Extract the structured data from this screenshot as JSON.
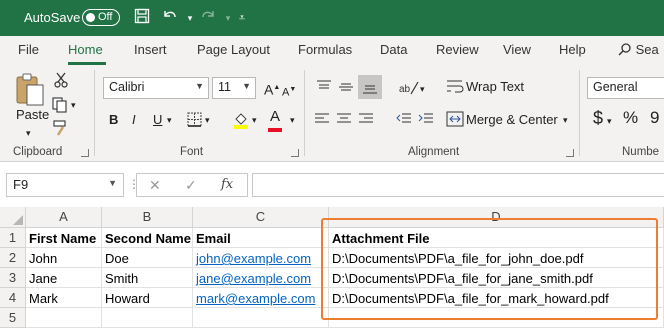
{
  "titlebar": {
    "autosave_label": "AutoSave",
    "autosave_state": "Off",
    "accent": "#217346"
  },
  "tabs": [
    "File",
    "Home",
    "Insert",
    "Page Layout",
    "Formulas",
    "Data",
    "Review",
    "View",
    "Help",
    "Sea"
  ],
  "active_tab": "Home",
  "ribbon": {
    "clipboard": {
      "paste_label": "Paste",
      "group_label": "Clipboard"
    },
    "font": {
      "font_name": "Calibri",
      "font_size": "11",
      "bold": "B",
      "italic": "I",
      "underline": "U",
      "font_color_letter": "A",
      "group_label": "Font"
    },
    "alignment": {
      "wrap_text": "Wrap Text",
      "merge_center": "Merge & Center",
      "group_label": "Alignment"
    },
    "number": {
      "format": "General",
      "currency": "$",
      "percent": "%",
      "group_label": "Numbe"
    }
  },
  "formula_bar": {
    "name_box": "F9",
    "cancel_glyph": "✕",
    "enter_glyph": "✓",
    "fx_label": "fx",
    "formula": ""
  },
  "grid": {
    "columns": [
      "A",
      "B",
      "C",
      "D"
    ],
    "rows": [
      "1",
      "2",
      "3",
      "4",
      "5"
    ],
    "headers": [
      "First Name",
      "Second Name",
      "Email",
      "Attachment File"
    ],
    "records": [
      [
        "John",
        "Doe",
        "john@example.com",
        "D:\\Documents\\PDF\\a_file_for_john_doe.pdf"
      ],
      [
        "Jane",
        "Smith",
        "jane@example.com",
        "D:\\Documents\\PDF\\a_file_for_jane_smith.pdf"
      ],
      [
        "Mark",
        "Howard",
        "mark@example.com",
        "D:\\Documents\\PDF\\a_file_for_mark_howard.pdf"
      ]
    ],
    "link_color": "#0563c1",
    "highlight_color": "#ed7d31"
  }
}
